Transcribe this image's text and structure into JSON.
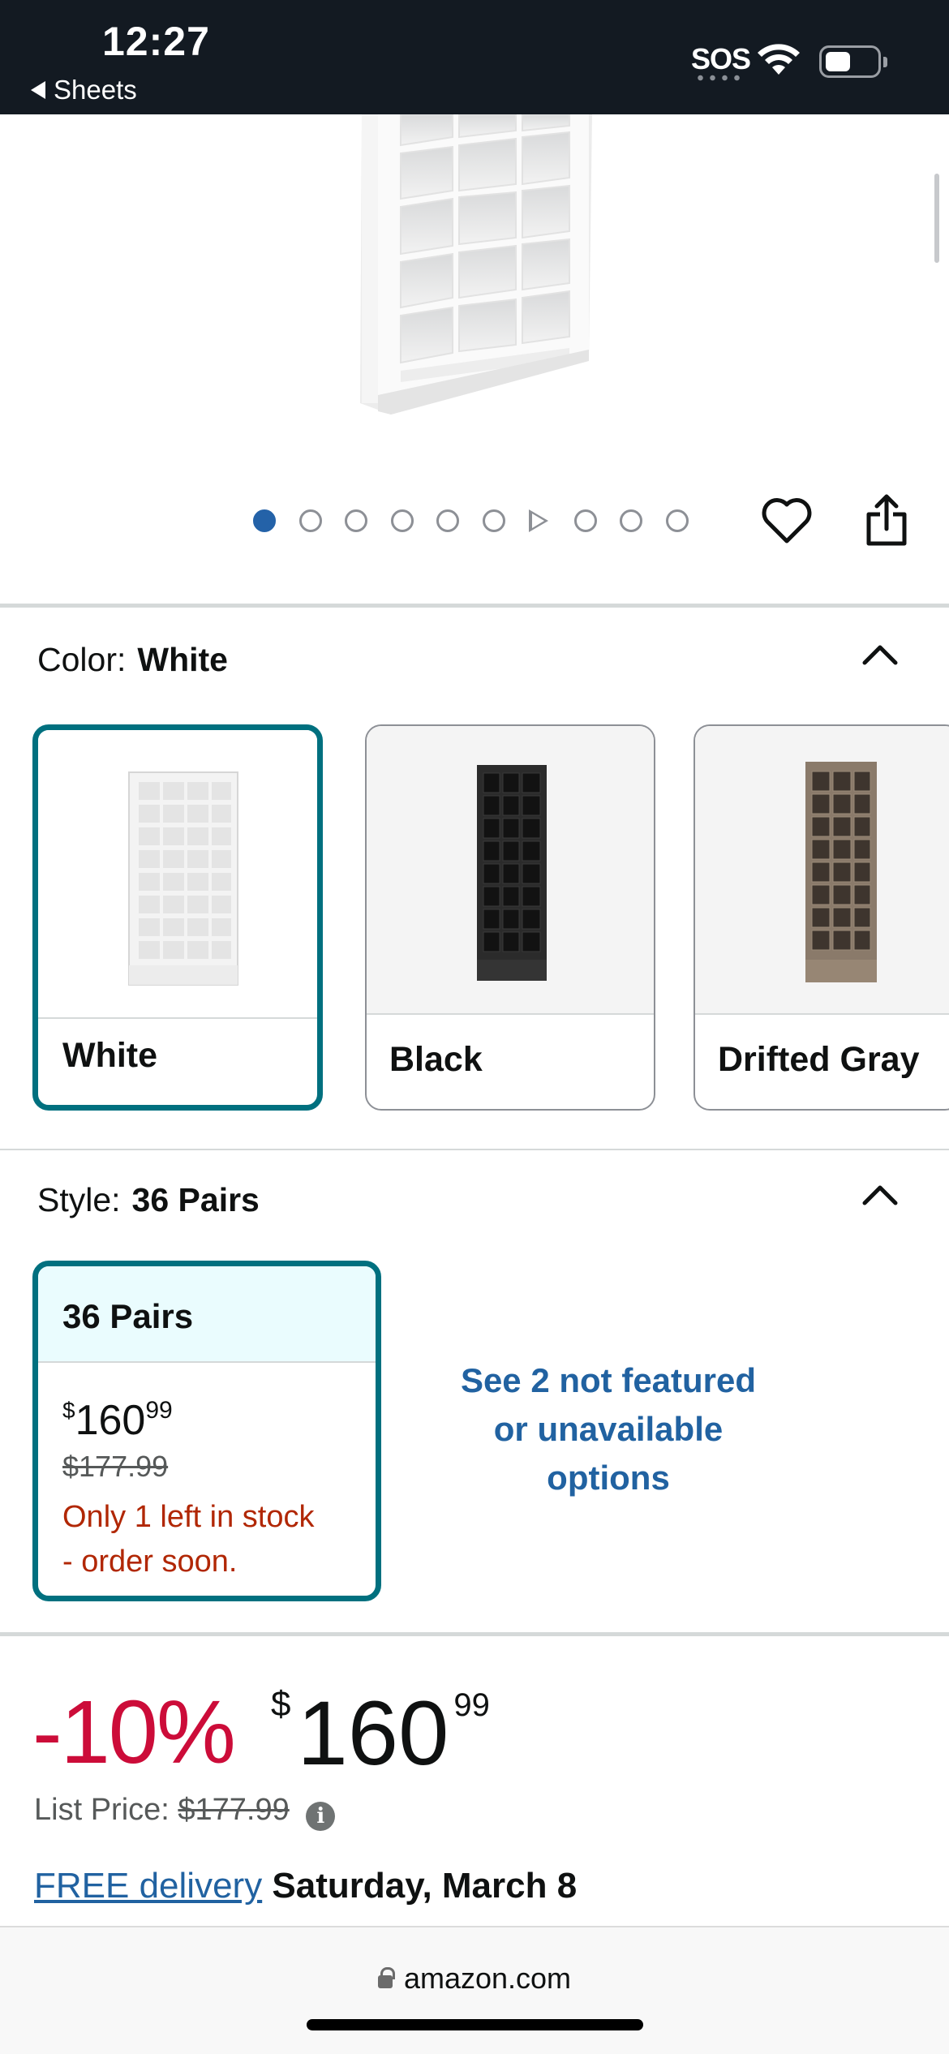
{
  "status_bar": {
    "time": "12:27",
    "back_label": "Sheets",
    "sos": "SOS"
  },
  "gallery": {
    "dot_count": 10,
    "active_index": 0,
    "video_index": 6
  },
  "color_section": {
    "label": "Color:",
    "selected": "White",
    "options": [
      {
        "name": "White",
        "selected": true
      },
      {
        "name": "Black",
        "selected": false
      },
      {
        "name": "Drifted Gray",
        "selected": false
      }
    ]
  },
  "style_section": {
    "label": "Style:",
    "selected": "36 Pairs",
    "card": {
      "title": "36 Pairs",
      "currency": "$",
      "price_whole": "160",
      "price_cents": "99",
      "was_price": "$177.99",
      "stock_line1": "Only 1 left in stock",
      "stock_line2": "- order soon."
    },
    "see_more_line1": "See 2 not featured",
    "see_more_line2": "or unavailable",
    "see_more_line3": "options"
  },
  "price_block": {
    "discount": "-10%",
    "currency": "$",
    "price_whole": "160",
    "price_cents": "99",
    "list_price_label": "List Price:",
    "list_price_value": "$177.99",
    "info_glyph": "i"
  },
  "delivery": {
    "link_text": "FREE delivery",
    "date": "Saturday, March 8"
  },
  "url_bar": {
    "domain": "amazon.com"
  },
  "colors": {
    "accent_teal": "#00707f",
    "link_blue": "#2162a1",
    "discount_red": "#cc0c39",
    "stock_red": "#b12704"
  }
}
